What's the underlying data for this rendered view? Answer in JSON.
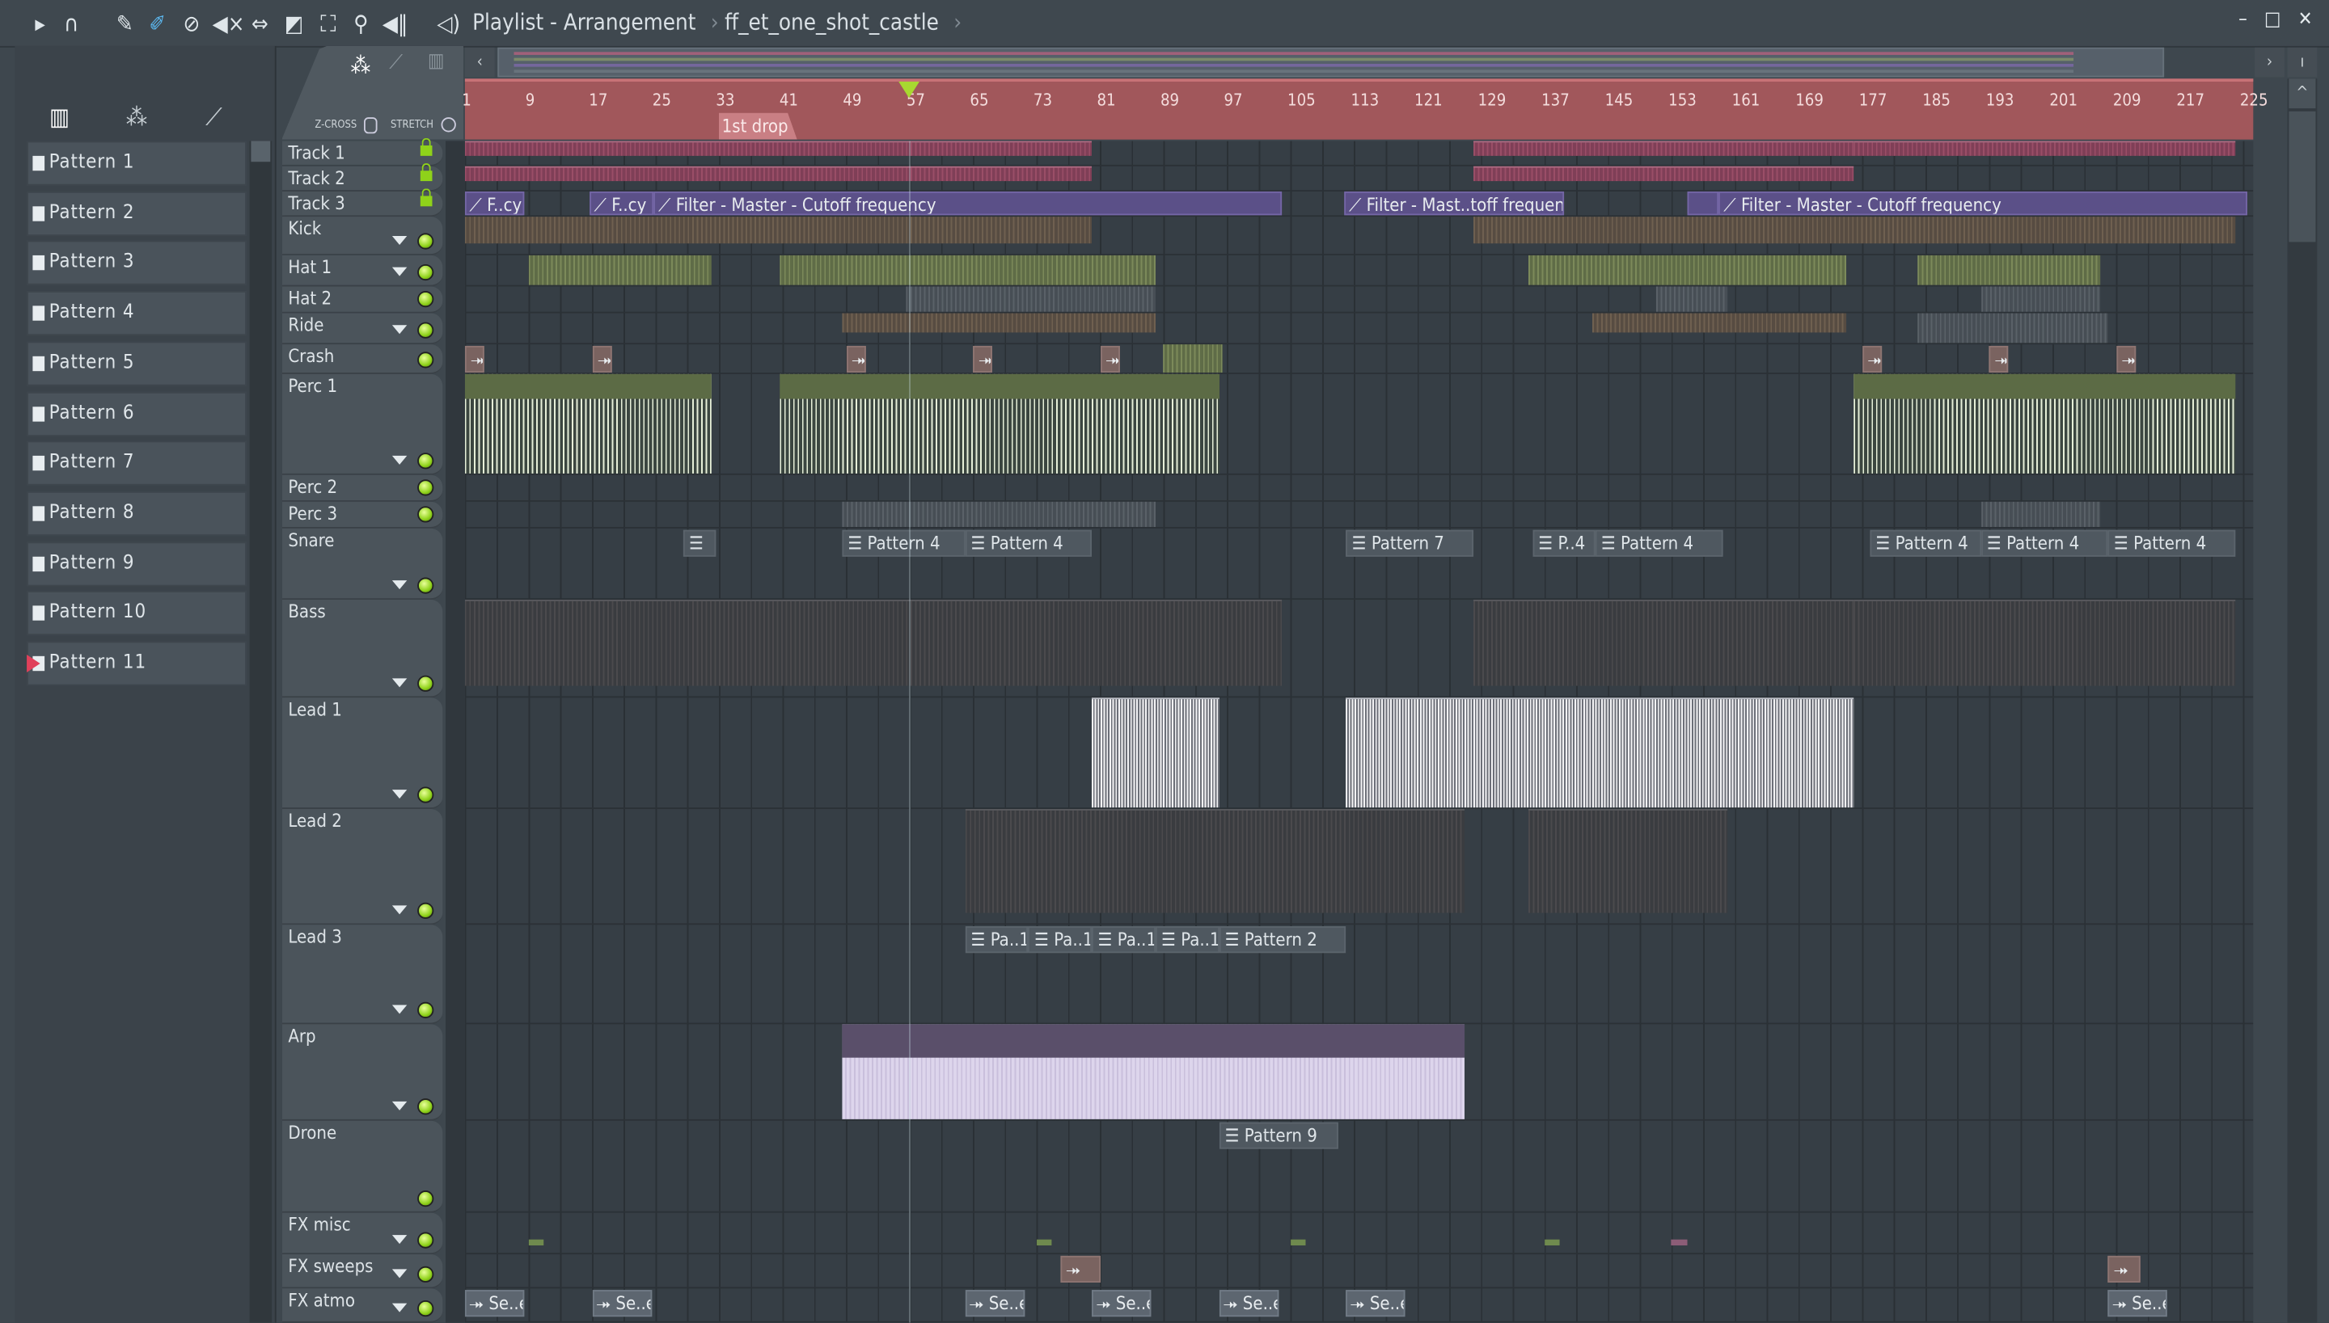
{
  "window": {
    "title": "Playlist - Arrangement",
    "project": "ff_et_one_shot_castle",
    "controls": [
      "minimize",
      "maximize",
      "close"
    ]
  },
  "toolbar": {
    "icons": [
      "play-menu-icon",
      "magnet-snap-icon",
      "pencil-draw-icon",
      "paint-brush-icon",
      "delete-icon",
      "mute-icon",
      "slip-icon",
      "slice-icon",
      "select-icon",
      "zoom-icon",
      "playback-icon",
      "speaker-icon"
    ]
  },
  "browser": {
    "tabs": [
      "piano-roll-icon",
      "audio-wave-icon",
      "automation-icon"
    ],
    "patterns": [
      "Pattern 1",
      "Pattern 2",
      "Pattern 3",
      "Pattern 4",
      "Pattern 5",
      "Pattern 6",
      "Pattern 7",
      "Pattern 8",
      "Pattern 9",
      "Pattern 10",
      "Pattern 11"
    ],
    "selected_pattern": "Pattern 11"
  },
  "header": {
    "zcross_label": "Z-CROSS",
    "stretch_label": "STRETCH"
  },
  "ruler": {
    "ticks": [
      "1",
      "9",
      "17",
      "25",
      "33",
      "41",
      "49",
      "57",
      "65",
      "73",
      "81",
      "89",
      "97",
      "105",
      "113",
      "121",
      "129",
      "137",
      "145",
      "153",
      "161",
      "169",
      "177",
      "185",
      "193",
      "201",
      "209",
      "217",
      "225"
    ],
    "marker": "1st drop",
    "marker_bar": 33,
    "playhead_bar": 57
  },
  "tracks": [
    {
      "name": "Track 1",
      "lock": true
    },
    {
      "name": "Track 2",
      "lock": true
    },
    {
      "name": "Track 3",
      "lock": true
    },
    {
      "name": "Kick",
      "dropdown": true,
      "led": true
    },
    {
      "name": "Hat 1",
      "dropdown": true,
      "led": true
    },
    {
      "name": "Hat 2",
      "led": true
    },
    {
      "name": "Ride",
      "dropdown": true,
      "led": true
    },
    {
      "name": "Crash",
      "led": true
    },
    {
      "name": "Perc 1",
      "dropdown": true,
      "led": true
    },
    {
      "name": "Perc 2",
      "led": true
    },
    {
      "name": "Perc 3",
      "led": true
    },
    {
      "name": "Snare",
      "dropdown": true,
      "led": true
    },
    {
      "name": "Bass",
      "dropdown": true,
      "led": true
    },
    {
      "name": "Lead 1",
      "dropdown": true,
      "led": true
    },
    {
      "name": "Lead 2",
      "dropdown": true,
      "led": true
    },
    {
      "name": "Lead 3",
      "dropdown": true,
      "led": true
    },
    {
      "name": "Arp",
      "dropdown": true,
      "led": true
    },
    {
      "name": "Drone",
      "led": true
    },
    {
      "name": "FX misc",
      "dropdown": true,
      "led": true
    },
    {
      "name": "FX sweeps",
      "dropdown": true,
      "led": true
    },
    {
      "name": "FX atmo",
      "dropdown": true,
      "led": true
    }
  ],
  "clips": [
    {
      "track": 0,
      "start": 1,
      "end": 80,
      "kind": "audio-pink",
      "label": ""
    },
    {
      "track": 0,
      "start": 128,
      "end": 176,
      "kind": "audio-pink",
      "label": ""
    },
    {
      "track": 0,
      "start": 176,
      "end": 224,
      "kind": "audio-pink",
      "label": ""
    },
    {
      "track": 1,
      "start": 1,
      "end": 80,
      "kind": "audio-pink",
      "label": ""
    },
    {
      "track": 1,
      "start": 128,
      "end": 176,
      "kind": "audio-pink",
      "label": ""
    },
    {
      "track": 2,
      "start": 1,
      "end": 8.5,
      "kind": "auto",
      "label": "F..cy"
    },
    {
      "track": 2,
      "start": 16.7,
      "end": 24.8,
      "kind": "auto",
      "label": "F..cy"
    },
    {
      "track": 2,
      "start": 24.8,
      "end": 104,
      "kind": "auto",
      "label": "Filter - Master - Cutoff frequency"
    },
    {
      "track": 2,
      "start": 111.8,
      "end": 139.5,
      "kind": "auto",
      "label": "Filter - Mast..toff frequency"
    },
    {
      "track": 2,
      "start": 155,
      "end": 159,
      "kind": "auto",
      "label": ""
    },
    {
      "track": 2,
      "start": 159,
      "end": 225.5,
      "kind": "auto",
      "label": "Filter - Master - Cutoff frequency"
    },
    {
      "track": 3,
      "start": 1,
      "end": 80,
      "kind": "audio-brown",
      "label": ""
    },
    {
      "track": 3,
      "start": 128,
      "end": 224,
      "kind": "audio-brown",
      "label": ""
    },
    {
      "track": 4,
      "start": 9,
      "end": 32,
      "kind": "audio-green",
      "label": ""
    },
    {
      "track": 4,
      "start": 40.7,
      "end": 88,
      "kind": "audio-green",
      "label": ""
    },
    {
      "track": 4,
      "start": 135,
      "end": 175,
      "kind": "audio-green",
      "label": ""
    },
    {
      "track": 4,
      "start": 184,
      "end": 207,
      "kind": "audio-green",
      "label": ""
    },
    {
      "track": 5,
      "start": 56.6,
      "end": 88,
      "kind": "audio-gray",
      "label": ""
    },
    {
      "track": 5,
      "start": 151,
      "end": 160,
      "kind": "audio-gray",
      "label": ""
    },
    {
      "track": 5,
      "start": 192,
      "end": 207,
      "kind": "audio-gray",
      "label": ""
    },
    {
      "track": 6,
      "start": 48.5,
      "end": 88,
      "kind": "audio-brown",
      "label": ""
    },
    {
      "track": 6,
      "start": 143,
      "end": 175,
      "kind": "audio-brown",
      "label": ""
    },
    {
      "track": 6,
      "start": 184,
      "end": 208,
      "kind": "audio-gray",
      "label": ""
    },
    {
      "track": 7,
      "start": 1,
      "end": 3.5,
      "kind": "oneshot",
      "label": "⯮"
    },
    {
      "track": 7,
      "start": 17,
      "end": 19.5,
      "kind": "oneshot",
      "label": "⯮"
    },
    {
      "track": 7,
      "start": 49,
      "end": 51.5,
      "kind": "oneshot",
      "label": "⯮"
    },
    {
      "track": 7,
      "start": 65,
      "end": 67.5,
      "kind": "oneshot",
      "label": "⯮"
    },
    {
      "track": 7,
      "start": 81,
      "end": 83.5,
      "kind": "oneshot",
      "label": "⯮"
    },
    {
      "track": 7,
      "start": 89,
      "end": 96.5,
      "kind": "audio-green",
      "label": ""
    },
    {
      "track": 7,
      "start": 177,
      "end": 179.5,
      "kind": "oneshot",
      "label": "⯮"
    },
    {
      "track": 7,
      "start": 193,
      "end": 195.5,
      "kind": "oneshot",
      "label": "⯮"
    },
    {
      "track": 7,
      "start": 209,
      "end": 211.5,
      "kind": "oneshot",
      "label": "⯮"
    },
    {
      "track": 8,
      "start": 1,
      "end": 32,
      "kind": "wave-green",
      "label": ""
    },
    {
      "track": 8,
      "start": 40.7,
      "end": 96,
      "kind": "wave-green",
      "label": ""
    },
    {
      "track": 8,
      "start": 176,
      "end": 224,
      "kind": "wave-green",
      "label": ""
    },
    {
      "track": 10,
      "start": 48.5,
      "end": 88,
      "kind": "audio-gray",
      "label": ""
    },
    {
      "track": 10,
      "start": 192,
      "end": 207,
      "kind": "audio-gray",
      "label": ""
    },
    {
      "track": 11,
      "start": 28.5,
      "end": 32.6,
      "kind": "pattern",
      "label": "☰"
    },
    {
      "track": 11,
      "start": 48.5,
      "end": 64,
      "kind": "pattern",
      "label": "Pattern 4"
    },
    {
      "track": 11,
      "start": 64,
      "end": 80,
      "kind": "pattern",
      "label": "Pattern 4"
    },
    {
      "track": 11,
      "start": 112,
      "end": 128,
      "kind": "pattern",
      "label": "Pattern 7"
    },
    {
      "track": 11,
      "start": 135.5,
      "end": 143.4,
      "kind": "pattern",
      "label": "P..4"
    },
    {
      "track": 11,
      "start": 143.4,
      "end": 159.5,
      "kind": "pattern",
      "label": "Pattern 4"
    },
    {
      "track": 11,
      "start": 178,
      "end": 192,
      "kind": "pattern",
      "label": "Pattern 4"
    },
    {
      "track": 11,
      "start": 192,
      "end": 208,
      "kind": "pattern",
      "label": "Pattern 4"
    },
    {
      "track": 11,
      "start": 208,
      "end": 224,
      "kind": "pattern",
      "label": "Pattern 4"
    },
    {
      "track": 12,
      "start": 1,
      "end": 104,
      "kind": "audio-dark",
      "label": ""
    },
    {
      "track": 12,
      "start": 128,
      "end": 176,
      "kind": "audio-dark",
      "label": ""
    },
    {
      "track": 12,
      "start": 176,
      "end": 224,
      "kind": "audio-dark",
      "label": ""
    },
    {
      "track": 13,
      "start": 80,
      "end": 96,
      "kind": "wave-white",
      "label": ""
    },
    {
      "track": 13,
      "start": 112,
      "end": 176,
      "kind": "wave-white",
      "label": ""
    },
    {
      "track": 14,
      "start": 64,
      "end": 127,
      "kind": "audio-dark",
      "label": ""
    },
    {
      "track": 14,
      "start": 135,
      "end": 160,
      "kind": "audio-dark",
      "label": ""
    },
    {
      "track": 15,
      "start": 64,
      "end": 72,
      "kind": "pattern",
      "label": "Pa..1"
    },
    {
      "track": 15,
      "start": 72,
      "end": 80,
      "kind": "pattern",
      "label": "Pa..1"
    },
    {
      "track": 15,
      "start": 80,
      "end": 88,
      "kind": "pattern",
      "label": "Pa..1"
    },
    {
      "track": 15,
      "start": 88,
      "end": 96,
      "kind": "pattern",
      "label": "Pa..1"
    },
    {
      "track": 15,
      "start": 96,
      "end": 112,
      "kind": "pattern",
      "label": "Pattern 2"
    },
    {
      "track": 16,
      "start": 48.5,
      "end": 127,
      "kind": "wave-lav",
      "label": ""
    },
    {
      "track": 17,
      "start": 96,
      "end": 111,
      "kind": "pattern",
      "label": "Pattern 9"
    },
    {
      "track": 18,
      "start": 9,
      "end": 11,
      "kind": "mini-green",
      "label": ""
    },
    {
      "track": 18,
      "start": 73,
      "end": 75,
      "kind": "mini-green",
      "label": ""
    },
    {
      "track": 18,
      "start": 105,
      "end": 107,
      "kind": "mini-green",
      "label": ""
    },
    {
      "track": 18,
      "start": 137,
      "end": 139,
      "kind": "mini-green",
      "label": ""
    },
    {
      "track": 18,
      "start": 153,
      "end": 155,
      "kind": "mini-pink",
      "label": ""
    },
    {
      "track": 19,
      "start": 76,
      "end": 81,
      "kind": "oneshot",
      "label": "⯮"
    },
    {
      "track": 19,
      "start": 208,
      "end": 212,
      "kind": "oneshot",
      "label": "⯮"
    },
    {
      "track": 20,
      "start": 1,
      "end": 8.5,
      "kind": "sample",
      "label": "Se..e"
    },
    {
      "track": 20,
      "start": 17,
      "end": 24.5,
      "kind": "sample",
      "label": "Se..e"
    },
    {
      "track": 20,
      "start": 64,
      "end": 71.5,
      "kind": "sample",
      "label": "Se..e"
    },
    {
      "track": 20,
      "start": 80,
      "end": 87.5,
      "kind": "sample",
      "label": "Se..e"
    },
    {
      "track": 20,
      "start": 96,
      "end": 103.5,
      "kind": "sample",
      "label": "Se..e"
    },
    {
      "track": 20,
      "start": 112,
      "end": 119.5,
      "kind": "sample",
      "label": "Se..e"
    },
    {
      "track": 20,
      "start": 208,
      "end": 215.5,
      "kind": "sample",
      "label": "Se..e"
    }
  ],
  "colors": {
    "ruler": "#a1575b",
    "accent_led": "#8fd21a",
    "automation": "#5b5088",
    "audio_pink": "#8c4a62"
  }
}
